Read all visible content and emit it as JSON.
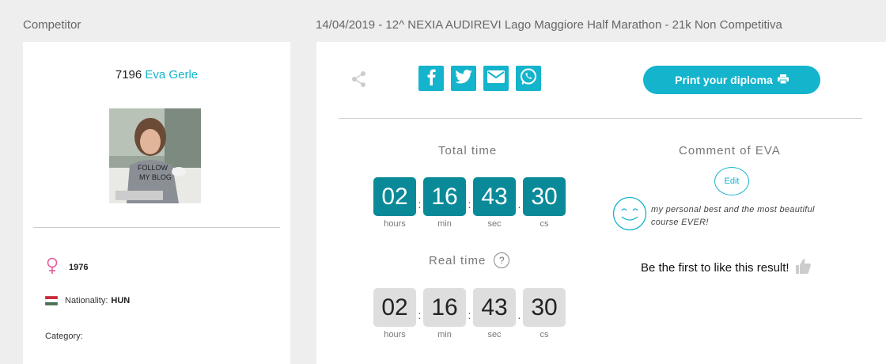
{
  "header": {
    "left_title": "Competitor",
    "race_title": "14/04/2019 - 12^ NEXIA AUDIREVI Lago Maggiore Half Marathon - 21k Non Competitiva"
  },
  "runner": {
    "bib": "7196",
    "name": "Eva Gerle",
    "birth_year": "1976",
    "nationality_label": "Nationality:",
    "nationality": "HUN",
    "category_label": "Category:"
  },
  "actions": {
    "print_label": "Print your diploma",
    "social": [
      "facebook-icon",
      "twitter-icon",
      "email-icon",
      "whatsapp-icon"
    ]
  },
  "total_time": {
    "label": "Total time",
    "hours": "02",
    "min": "16",
    "sec": "43",
    "cs": "30"
  },
  "real_time": {
    "label": "Real time",
    "help": "?",
    "hours": "02",
    "min": "16",
    "sec": "43",
    "cs": "30"
  },
  "units": {
    "hours": "hours",
    "min": "min",
    "sec": "sec",
    "cs": "cs"
  },
  "comment": {
    "title": "Comment of EVA",
    "edit_label": "Edit",
    "text": "my personal best and the most beautiful course EVER!"
  },
  "like": {
    "text": "Be the first to like this result!"
  },
  "colors": {
    "accent": "#14b4cc",
    "timer": "#0a8a98",
    "timer_real": "#dedede",
    "female": "#e85a9a"
  }
}
